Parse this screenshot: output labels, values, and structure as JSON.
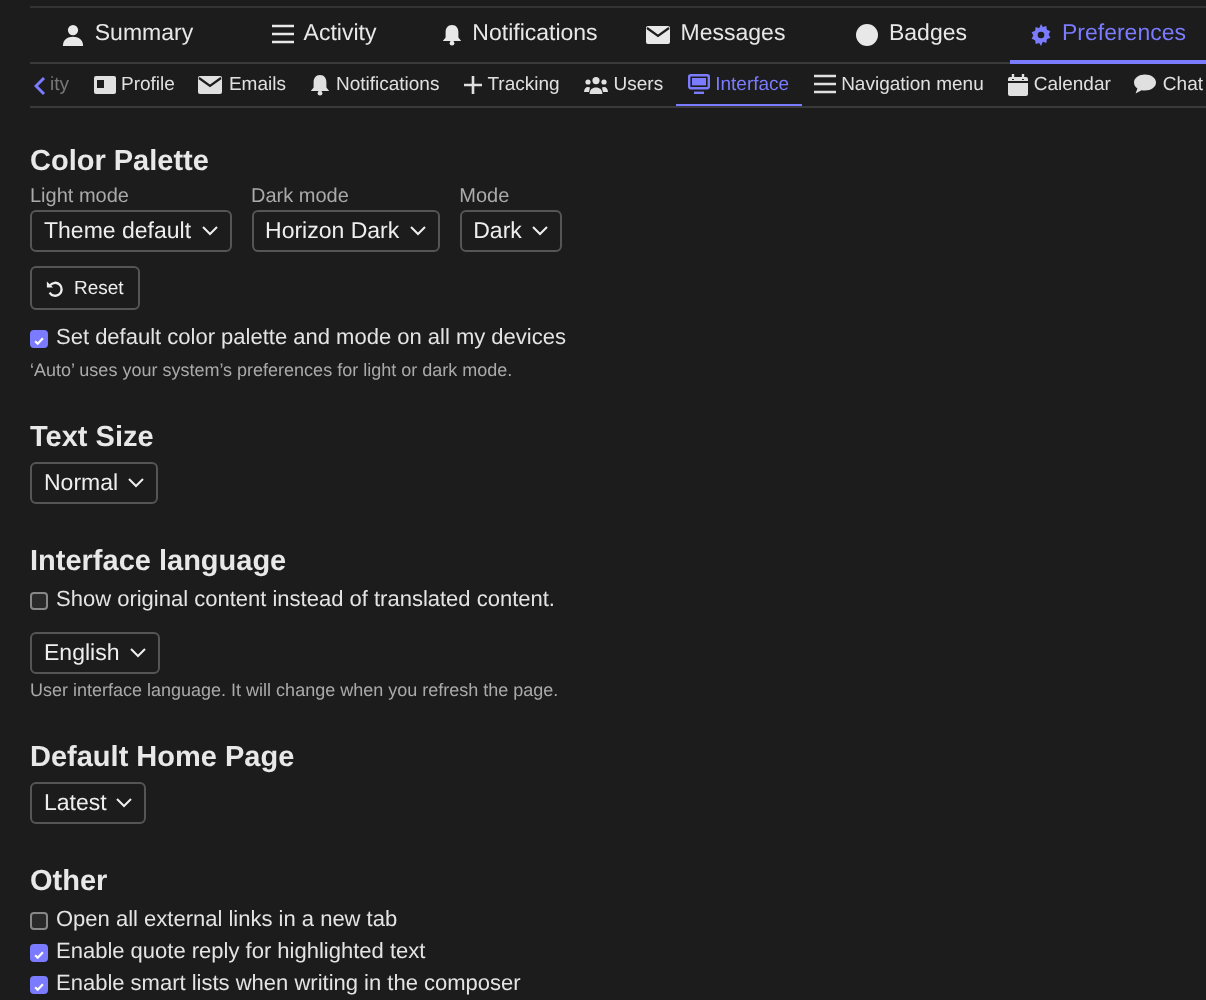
{
  "main_tabs": [
    {
      "label": "Summary",
      "selected": false
    },
    {
      "label": "Activity",
      "selected": false
    },
    {
      "label": "Notifications",
      "selected": false
    },
    {
      "label": "Messages",
      "selected": false
    },
    {
      "label": "Badges",
      "selected": false
    },
    {
      "label": "Preferences",
      "selected": true
    }
  ],
  "sub_tabs": [
    {
      "label": "ity",
      "selected": false
    },
    {
      "label": "Profile",
      "selected": false
    },
    {
      "label": "Emails",
      "selected": false
    },
    {
      "label": "Notifications",
      "selected": false
    },
    {
      "label": "Tracking",
      "selected": false
    },
    {
      "label": "Users",
      "selected": false
    },
    {
      "label": "Interface",
      "selected": true
    },
    {
      "label": "Navigation menu",
      "selected": false
    },
    {
      "label": "Calendar",
      "selected": false
    },
    {
      "label": "Chat",
      "selected": false
    }
  ],
  "sections": [
    {
      "title": "Color Palette",
      "items": [
        {
          "kind": "select-row",
          "selects": [
            {
              "label": "Light mode",
              "value": "Theme default"
            },
            {
              "label": "Dark mode",
              "value": "Horizon Dark"
            },
            {
              "label": "Mode",
              "value": "Dark"
            }
          ]
        },
        {
          "kind": "button",
          "label": "Reset"
        },
        {
          "kind": "checkbox",
          "label": "Set default color palette and mode on all my devices",
          "checked": true
        },
        {
          "kind": "help",
          "text": "‘Auto’ uses your system’s preferences for light or dark mode."
        }
      ]
    },
    {
      "title": "Text Size",
      "items": [
        {
          "kind": "select",
          "value": "Normal"
        }
      ]
    },
    {
      "title": "Interface language",
      "items": [
        {
          "kind": "checkbox",
          "label": "Show original content instead of translated content.",
          "checked": false
        },
        {
          "kind": "select",
          "value": "English"
        },
        {
          "kind": "help",
          "text": "User interface language. It will change when you refresh the page."
        }
      ]
    },
    {
      "title": "Default Home Page",
      "items": [
        {
          "kind": "select",
          "value": "Latest"
        }
      ]
    },
    {
      "title": "Other",
      "items": [
        {
          "kind": "checkbox",
          "label": "Open all external links in a new tab",
          "checked": false
        },
        {
          "kind": "checkbox",
          "label": "Enable quote reply for highlighted text",
          "checked": true
        },
        {
          "kind": "checkbox",
          "label": "Enable smart lists when writing in the composer",
          "checked": true
        }
      ]
    }
  ]
}
